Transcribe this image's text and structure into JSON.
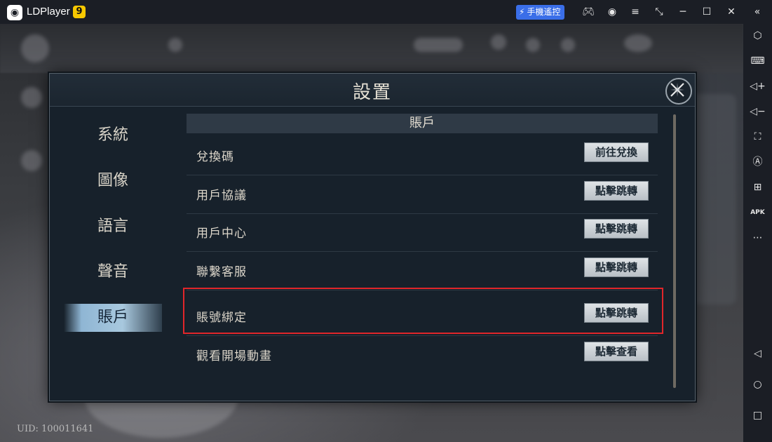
{
  "titlebar": {
    "app_name": "LDPlayer",
    "version": "9",
    "remote_label": "手機遙控",
    "icons": [
      "gamepad-icon",
      "account-icon",
      "menu-icon",
      "window-shrink-icon",
      "minimize-icon",
      "maximize-icon",
      "close-icon",
      "collapse-sidebar-icon"
    ]
  },
  "sidebar": {
    "icons": [
      "gear-hex-icon",
      "keyboard-icon",
      "volume-up-icon",
      "volume-down-icon",
      "screenshot-icon",
      "auto-rotate-icon",
      "add-instance-icon",
      "apk-install-icon",
      "more-icon",
      "back-icon",
      "home-icon",
      "recents-icon"
    ],
    "apk_label": "APK"
  },
  "dialog": {
    "title": "設置",
    "nav": [
      {
        "label": "系統"
      },
      {
        "label": "圖像"
      },
      {
        "label": "語言"
      },
      {
        "label": "聲音"
      },
      {
        "label": "賬戶",
        "active": true
      }
    ],
    "section_title": "賬戶",
    "rows": [
      {
        "label": "兌換碼",
        "button": "前往兌換"
      },
      {
        "label": "用戶協議",
        "button": "點擊跳轉"
      },
      {
        "label": "用戶中心",
        "button": "點擊跳轉"
      },
      {
        "label": "聯繫客服",
        "button": "點擊跳轉"
      },
      {
        "label": "賬號綁定",
        "button": "點擊跳轉",
        "highlighted": true
      },
      {
        "label": "觀看開場動畫",
        "button": "點擊查看"
      }
    ]
  },
  "footer": {
    "uid": "UID: 100011641"
  },
  "colors": {
    "highlight_border": "#e1262a",
    "remote_button": "#3a6ee8",
    "version_badge": "#f7c800"
  }
}
